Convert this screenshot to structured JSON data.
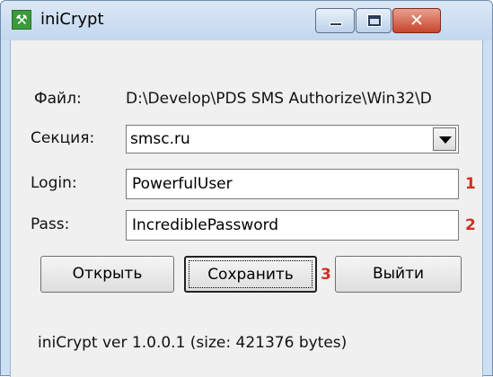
{
  "window": {
    "title": "iniCrypt",
    "icon": "tools-icon",
    "controls": {
      "minimize": "minimize-icon",
      "maximize": "maximize-icon",
      "close": "✕"
    }
  },
  "form": {
    "file_label": "Файл:",
    "file_value": "D:\\Develop\\PDS SMS Authorize\\Win32\\D",
    "section_label": "Секция:",
    "section_value": "smsc.ru",
    "login_label": "Login:",
    "login_value": "PowerfulUser",
    "pass_label": "Pass:",
    "pass_value": "IncrediblePassword"
  },
  "markers": {
    "login": "1",
    "pass": "2",
    "save": "3"
  },
  "buttons": {
    "open": "Открыть",
    "save": "Сохранить",
    "exit": "Выйти"
  },
  "status": "iniCrypt ver 1.0.0.1 (size: 421376 bytes)",
  "colors": {
    "marker": "#d0301e",
    "close_button": "#c8442c",
    "app_icon": "#3c9a3c"
  }
}
